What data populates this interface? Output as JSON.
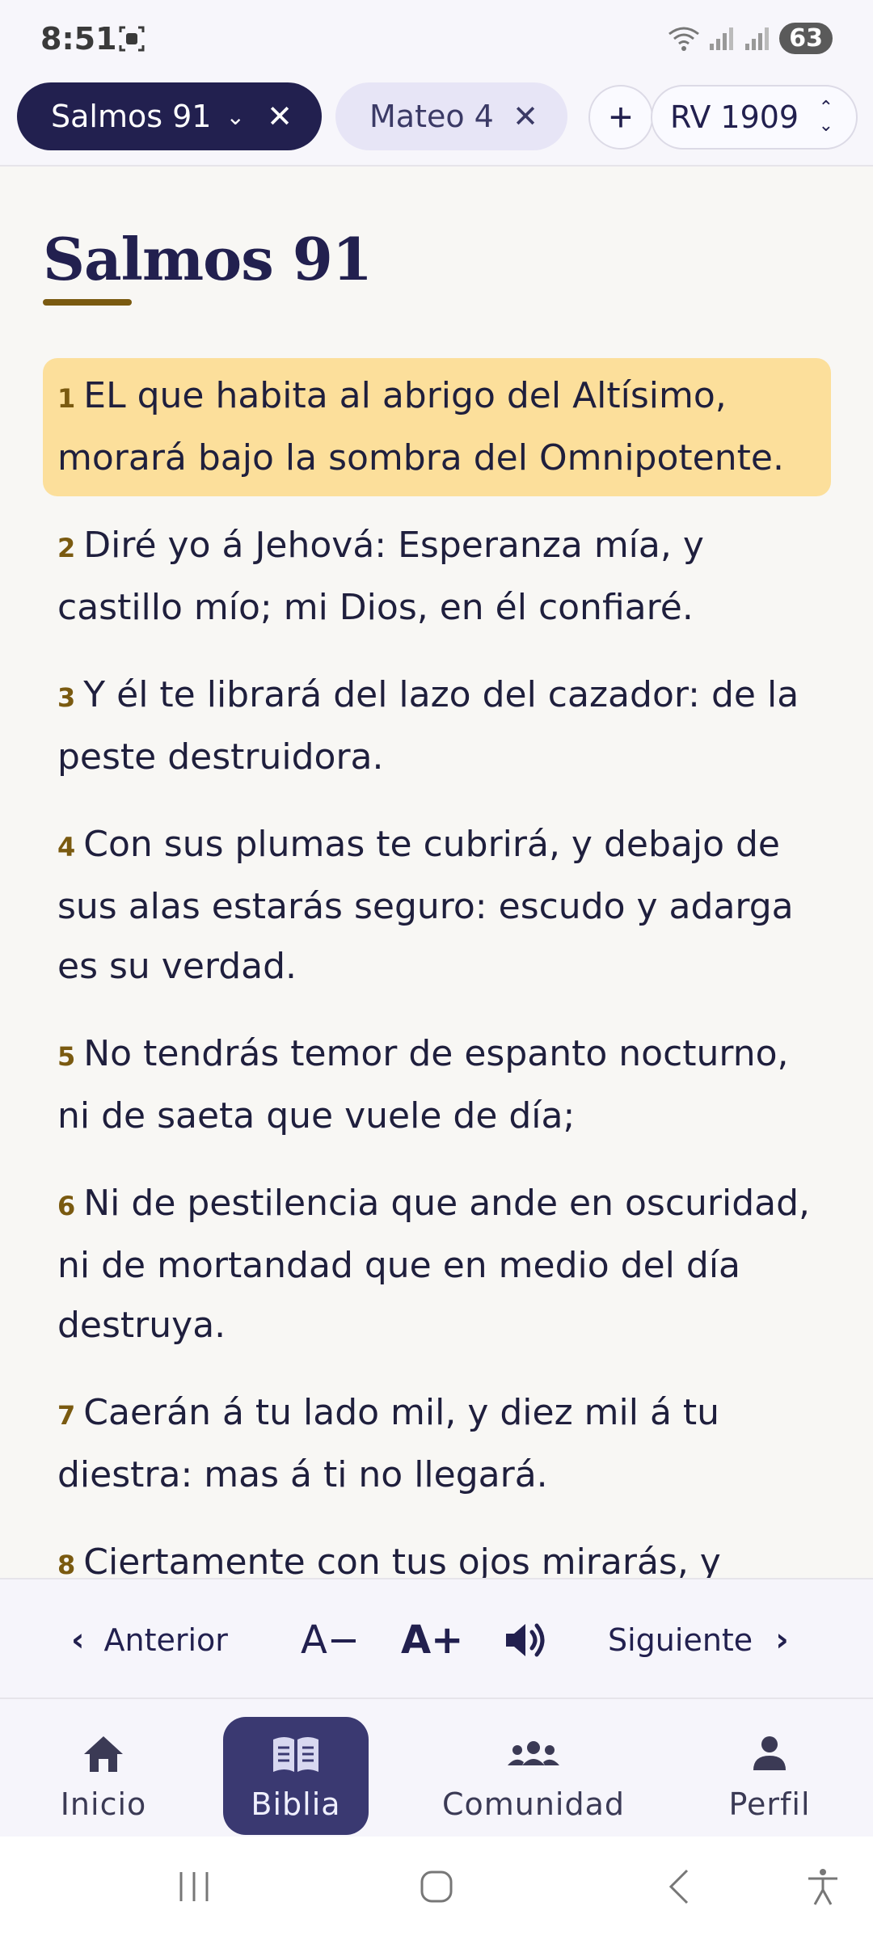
{
  "status_bar": {
    "time": "8:51",
    "battery": "63"
  },
  "tabs": [
    {
      "label": "Salmos 91",
      "active": true
    },
    {
      "label": "Mateo 4",
      "active": false
    }
  ],
  "version": "RV 1909",
  "chapter": {
    "title": "Salmos 91",
    "verses": [
      {
        "num": "1",
        "text": "EL que habita al abrigo del Altísimo, morará bajo la sombra del Omnipotente.",
        "highlighted": true
      },
      {
        "num": "2",
        "text": "Diré yo á Jehová: Esperanza mía, y castillo mío; mi Dios, en él confiaré."
      },
      {
        "num": "3",
        "text": "Y él te librará del lazo del cazador: de la peste destruidora."
      },
      {
        "num": "4",
        "text": "Con sus plumas te cubrirá, y debajo de sus alas estarás seguro: escudo y adarga es su verdad."
      },
      {
        "num": "5",
        "text": "No tendrás temor de espanto nocturno, ni de saeta que vuele de día;"
      },
      {
        "num": "6",
        "text": "Ni de pestilencia que ande en oscuridad, ni de mortandad que en medio del día destruya."
      },
      {
        "num": "7",
        "text": "Caerán á tu lado mil, y diez mil á tu diestra: mas á ti no llegará."
      },
      {
        "num": "8",
        "text": "Ciertamente con tus ojos mirarás, y verás la recompensa de los impíos."
      }
    ]
  },
  "reader_toolbar": {
    "prev_label": "Anterior",
    "font_dec_label": "A−",
    "font_inc_label": "A+",
    "next_label": "Siguiente"
  },
  "bottom_nav": {
    "items": [
      {
        "label": "Inicio",
        "icon": "home-icon"
      },
      {
        "label": "Biblia",
        "icon": "book-icon",
        "active": true
      },
      {
        "label": "Comunidad",
        "icon": "group-icon"
      },
      {
        "label": "Perfil",
        "icon": "person-icon"
      }
    ]
  },
  "colors": {
    "primary": "#22204f",
    "accent_gold": "#7a5a10",
    "highlight": "#fcdf9b",
    "nav_active": "#3a3971"
  }
}
